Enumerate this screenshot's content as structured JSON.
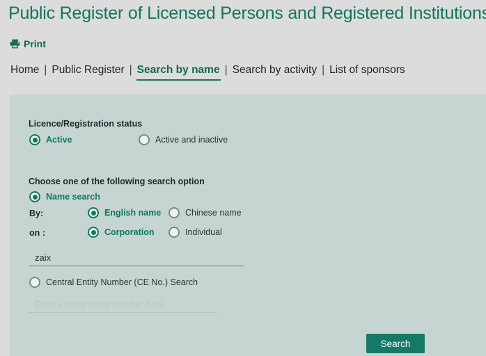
{
  "header": {
    "title": "Public Register of Licensed Persons and Registered Institutions",
    "print_label": "Print",
    "print_icon": "printer-icon"
  },
  "nav": {
    "separator": "|",
    "items": [
      {
        "label": "Home",
        "active": false
      },
      {
        "label": "Public Register",
        "active": false
      },
      {
        "label": "Search by name",
        "active": true
      },
      {
        "label": "Search by activity",
        "active": false
      },
      {
        "label": "List of sponsors",
        "active": false
      }
    ]
  },
  "form": {
    "status": {
      "heading": "Licence/Registration status",
      "options": [
        {
          "label": "Active",
          "selected": true
        },
        {
          "label": "Active and inactive",
          "selected": false
        }
      ]
    },
    "search_option": {
      "heading": "Choose one of the following search option",
      "name_search": {
        "label": "Name search",
        "selected": true,
        "by_label": "By:",
        "by_options": [
          {
            "label": "English name",
            "selected": true
          },
          {
            "label": "Chinese name",
            "selected": false
          }
        ],
        "on_label": "on :",
        "on_options": [
          {
            "label": "Corporation",
            "selected": true
          },
          {
            "label": "Individual",
            "selected": false
          }
        ],
        "input_value": "zaix",
        "input_placeholder": ""
      },
      "ce_search": {
        "label": "Central Entity Number (CE No.) Search",
        "selected": false,
        "input_value": "",
        "input_placeholder": "Enter central entity number here"
      }
    },
    "submit_label": "Search"
  },
  "colors": {
    "brand_green": "#0c7a5e",
    "title_green": "#11765f",
    "panel_bg": "#c6d4d2",
    "page_bg": "#dcdcdc",
    "button_bg": "#147a68"
  }
}
